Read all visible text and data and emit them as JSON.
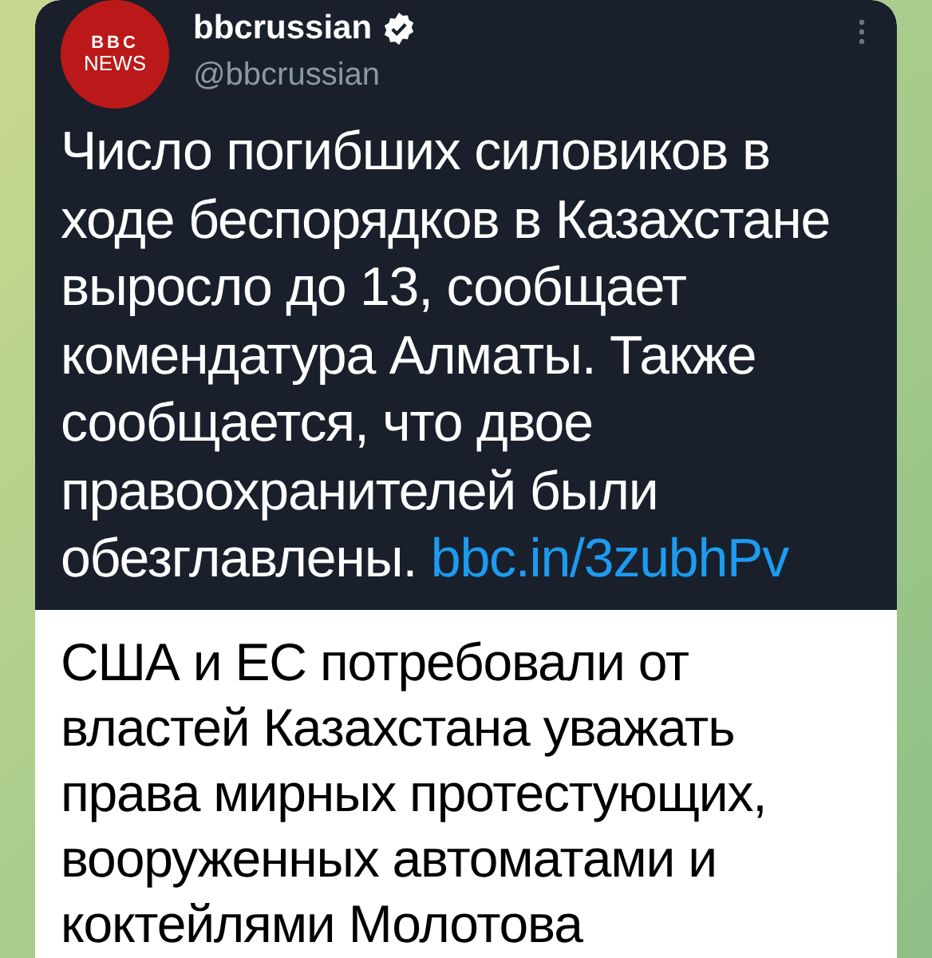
{
  "tweet": {
    "avatar_text": [
      "BBC",
      "NEWS"
    ],
    "author": "bbcrussian",
    "verified": true,
    "handle": "@bbcrussian",
    "text": "Число погибших силовиков в ходе беспорядков в Казахстане выросло до 13, сообщает комендатура Алматы. Также сообщается, что двое правоохранителей были обезглавлены.",
    "link": "bbc.in/3zubhPv"
  },
  "message": {
    "text": "США и ЕС потребовали от властей Казахстана уважать права мирных протестующих, вооруженных автоматами и коктейлями Молотова"
  }
}
